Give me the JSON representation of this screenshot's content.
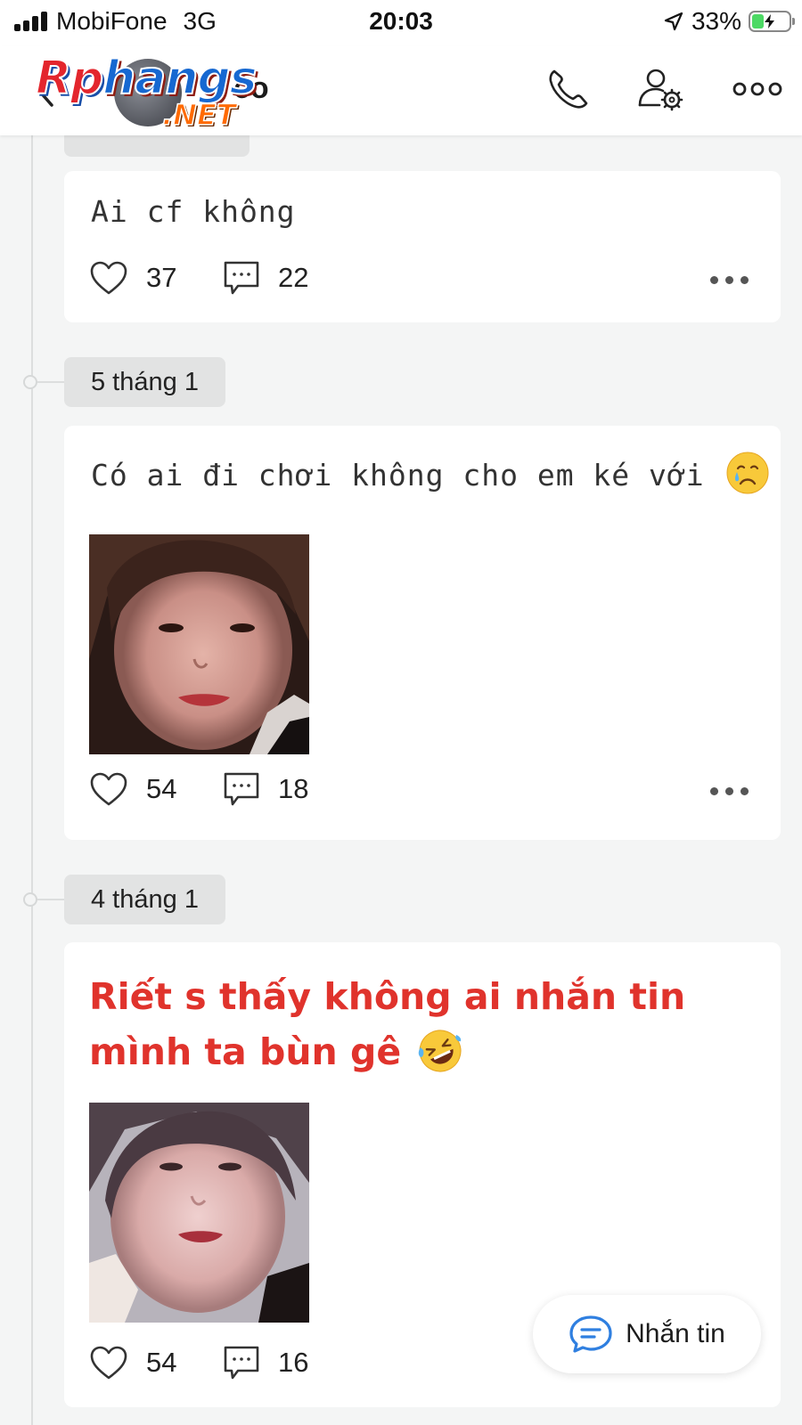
{
  "status_bar": {
    "carrier": "MobiFone",
    "network": "3G",
    "time": "20:03",
    "battery": "33%",
    "battery_level": 0.33,
    "battery_color": "#4cd964"
  },
  "header": {
    "name_visible": "eo",
    "watermark": "Rphangs.NET",
    "icons": [
      "back-chevron-icon",
      "phone-icon",
      "profile-settings-icon",
      "more-horizontal-icon"
    ]
  },
  "timeline": {
    "dates": [
      "5 tháng 1",
      "4 tháng 1"
    ],
    "posts": [
      {
        "text": "Ai cf không",
        "likes": "37",
        "comments": "22"
      },
      {
        "text": "Có ai đi chơi không cho em ké với",
        "emoji": "crying-face",
        "likes": "54",
        "comments": "18"
      },
      {
        "text": "Riết s thấy không ai nhắn tin mình ta bùn gê",
        "emoji": "rolling-laughing-face",
        "likes": "54",
        "comments": "16"
      }
    ]
  },
  "message_button": {
    "label": "Nhắn tin"
  },
  "colors": {
    "background": "#f4f5f5",
    "card": "#ffffff",
    "date_chip": "#e2e3e3",
    "red_text": "#e0332c",
    "message_icon": "#2f7fe0"
  }
}
